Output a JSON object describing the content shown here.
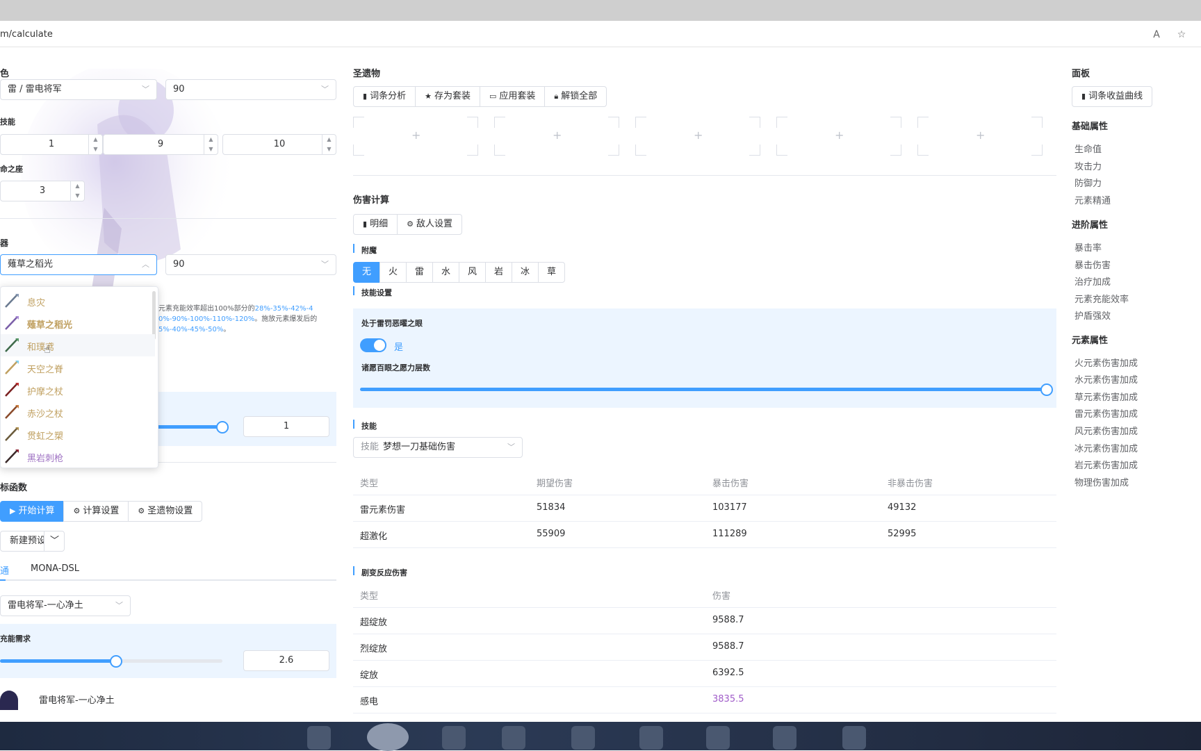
{
  "browser": {
    "url": "m/calculate"
  },
  "left": {
    "character_label": "色",
    "character_value": "雷 / 雷电将军",
    "character_level": "90",
    "skill_label": "技能",
    "skill_levels": [
      "1",
      "9",
      "10"
    ],
    "constellation_label": "命之座",
    "constellation_value": "3",
    "weapon_label": "器",
    "weapon_value": "薙草之稻光",
    "weapon_level": "90",
    "weapon_desc_line1": "元素充能效率超出100%部分的",
    "weapon_desc_hl1": "28%-35%-42%-4",
    "weapon_desc_line2a": "0%-90%-100%-110%-120%",
    "weapon_desc_line2b": "。施放元素爆发后的",
    "weapon_desc_line3": "5%-40%-45%-50%",
    "weapon_desc_line3b": "。",
    "refine_value": "1",
    "target_label": "标函数",
    "buttons": {
      "start": "开始计算",
      "calc_settings": "计算设置",
      "artifact_settings": "圣遗物设置"
    },
    "preset": "新建预设",
    "tabs": [
      "通",
      "MONA-DSL"
    ],
    "target_select": "雷电将军-一心净土",
    "energy_label": "充能需求",
    "energy_value": "2.6",
    "footer_char": "雷电将军-一心净土"
  },
  "dropdown": {
    "items": [
      {
        "name": "息灾",
        "color": "#c0a060"
      },
      {
        "name": "薙草之稻光",
        "color": "#c0a060"
      },
      {
        "name": "和璞鸢",
        "color": "#c0a060"
      },
      {
        "name": "天空之脊",
        "color": "#c0a060"
      },
      {
        "name": "护摩之杖",
        "color": "#c0a060"
      },
      {
        "name": "赤沙之杖",
        "color": "#c0a060"
      },
      {
        "name": "贯虹之槊",
        "color": "#c0a060"
      },
      {
        "name": "黑岩刺枪",
        "color": "#a074c4"
      }
    ]
  },
  "artifacts": {
    "title": "圣遗物",
    "buttons": [
      "词条分析",
      "存为套装",
      "应用套装",
      "解锁全部"
    ]
  },
  "damage": {
    "title": "伤害计算",
    "buttons": [
      "明细",
      "敌人设置"
    ],
    "infusion_label": "附魔",
    "elements": [
      "无",
      "火",
      "雷",
      "水",
      "风",
      "岩",
      "冰",
      "草"
    ],
    "skill_settings_label": "技能设置",
    "eye_label": "处于雷罚恶曜之眼",
    "eye_value": "是",
    "stacks_label": "诸愿百眼之愿力层数",
    "stacks_fill": 1.0,
    "skill_label": "技能",
    "skill_prefix": "技能",
    "skill_select": "梦想一刀基础伤害",
    "table": {
      "headers": [
        "类型",
        "期望伤害",
        "暴击伤害",
        "非暴击伤害"
      ],
      "rows": [
        [
          "雷元素伤害",
          "51834",
          "103177",
          "49132"
        ],
        [
          "超激化",
          "55909",
          "111289",
          "52995"
        ]
      ]
    },
    "transform_label": "剧变反应伤害",
    "transform_table": {
      "headers": [
        "类型",
        "伤害"
      ],
      "rows": [
        [
          "超绽放",
          "9588.7"
        ],
        [
          "烈绽放",
          "9588.7"
        ],
        [
          "绽放",
          "6392.5"
        ],
        [
          "感电",
          "3835.5"
        ]
      ]
    }
  },
  "panel": {
    "title": "面板",
    "curve_button": "词条收益曲线",
    "basic_head": "基础属性",
    "basic": [
      "生命值",
      "攻击力",
      "防御力",
      "元素精通"
    ],
    "advanced_head": "进阶属性",
    "advanced": [
      "暴击率",
      "暴击伤害",
      "治疗加成",
      "元素充能效率",
      "护盾强效"
    ],
    "element_head": "元素属性",
    "element": [
      "火元素伤害加成",
      "水元素伤害加成",
      "草元素伤害加成",
      "雷元素伤害加成",
      "风元素伤害加成",
      "冰元素伤害加成",
      "岩元素伤害加成",
      "物理伤害加成"
    ]
  },
  "colors": {
    "accent": "#409eff",
    "electro_text": "#a05cc9"
  }
}
